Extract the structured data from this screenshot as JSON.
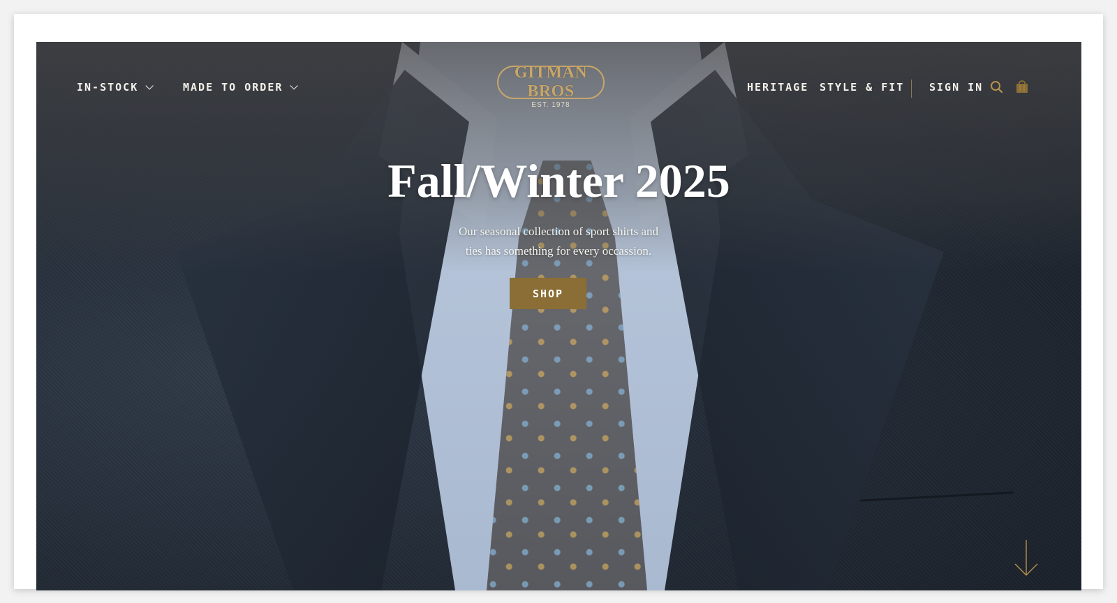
{
  "nav": {
    "left_items": [
      {
        "label": "IN-STOCK"
      },
      {
        "label": "MADE TO ORDER"
      }
    ],
    "right_items": [
      {
        "label": "HERITAGE"
      },
      {
        "label": "STYLE & FIT"
      },
      {
        "label": "SIGN IN"
      }
    ],
    "icons": {
      "search": "search-icon",
      "cart": "shopping-bag-icon"
    }
  },
  "logo": {
    "name": "GITMAN BROS",
    "est": "EST. 1978"
  },
  "hero": {
    "title": "Fall/Winter 2025",
    "subtitle_line1": "Our seasonal collection of sport shirts and",
    "subtitle_line2": "ties has something for every occassion.",
    "cta_label": "SHOP"
  },
  "colors": {
    "accent_gold": "#8a6e35",
    "logo_gold": "#c7a66a",
    "text_light": "#f4f1ea"
  }
}
